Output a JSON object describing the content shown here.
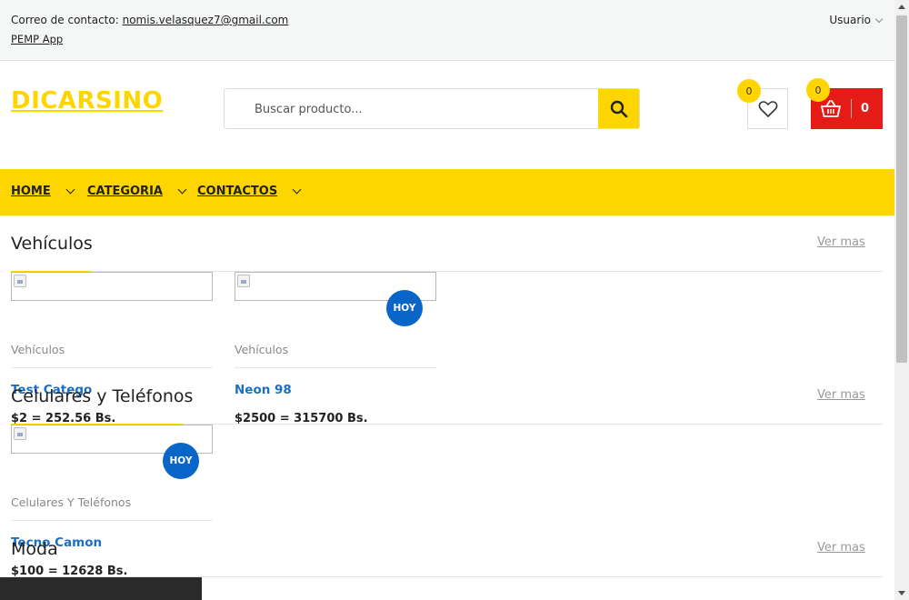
{
  "topbar": {
    "contact_label": "Correo de contacto:",
    "contact_email": "nomis.velasquez7@gmail.com",
    "app_link": "PEMP App",
    "user_menu": "Usuario"
  },
  "header": {
    "logo": "DICARSINO",
    "search_placeholder": "Buscar producto...",
    "wishlist_count": "0",
    "cart_badge": "0",
    "cart_total": "0"
  },
  "nav": {
    "items": [
      {
        "label": "HOME"
      },
      {
        "label": "CATEGORIA"
      },
      {
        "label": "CONTACTOS"
      }
    ]
  },
  "sections": [
    {
      "title": "Vehículos",
      "more": "Ver mas",
      "products": [
        {
          "category": "Vehículos",
          "name": "Test Catego",
          "price": "$2 = 252.56 Bs."
        },
        {
          "category": "Vehículos",
          "name": "Neon 98",
          "price": "$2500 = 315700 Bs.",
          "badge": "HOY"
        }
      ]
    },
    {
      "title": "Celulares y Teléfonos",
      "more": "Ver mas",
      "products": [
        {
          "category": "Celulares Y Teléfonos",
          "name": "Tecno Camon",
          "price": "$100 = 12628 Bs.",
          "badge": "HOY"
        }
      ]
    },
    {
      "title": "Moda",
      "more": "Ver mas",
      "products": []
    }
  ],
  "colors": {
    "accent": "#ffd500",
    "cart": "#e41b17",
    "badge_blue": "#0a65c9",
    "link": "#1a6fc4"
  }
}
